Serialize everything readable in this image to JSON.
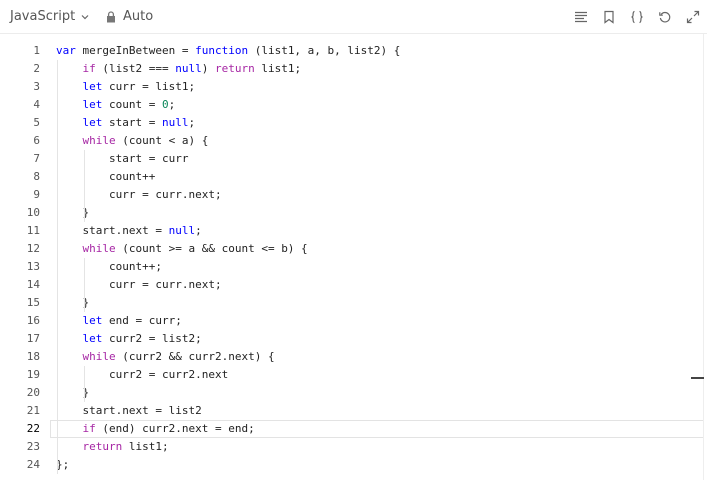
{
  "toolbar": {
    "language": "JavaScript",
    "mode": "Auto",
    "tools": [
      {
        "name": "format-icon"
      },
      {
        "name": "bookmark-icon"
      },
      {
        "name": "braces-icon"
      },
      {
        "name": "reset-icon"
      },
      {
        "name": "expand-icon"
      }
    ]
  },
  "editor": {
    "active_line": 22,
    "lines": [
      "var mergeInBetween = function (list1, a, b, list2) {",
      "    if (list2 === null) return list1;",
      "    let curr = list1;",
      "    let count = 0;",
      "    let start = null;",
      "    while (count < a) {",
      "        start = curr",
      "        count++",
      "        curr = curr.next;",
      "    }",
      "    start.next = null;",
      "    while (count >= a && count <= b) {",
      "        count++;",
      "        curr = curr.next;",
      "    }",
      "    let end = curr;",
      "    let curr2 = list2;",
      "    while (curr2 && curr2.next) {",
      "        curr2 = curr2.next",
      "    }",
      "    start.next = list2",
      "    if (end) curr2.next = end;",
      "    return list1;",
      "};"
    ]
  },
  "colors": {
    "keyword": "#a626a4",
    "keyword_decl": "#0000ff",
    "number": "#098658"
  }
}
